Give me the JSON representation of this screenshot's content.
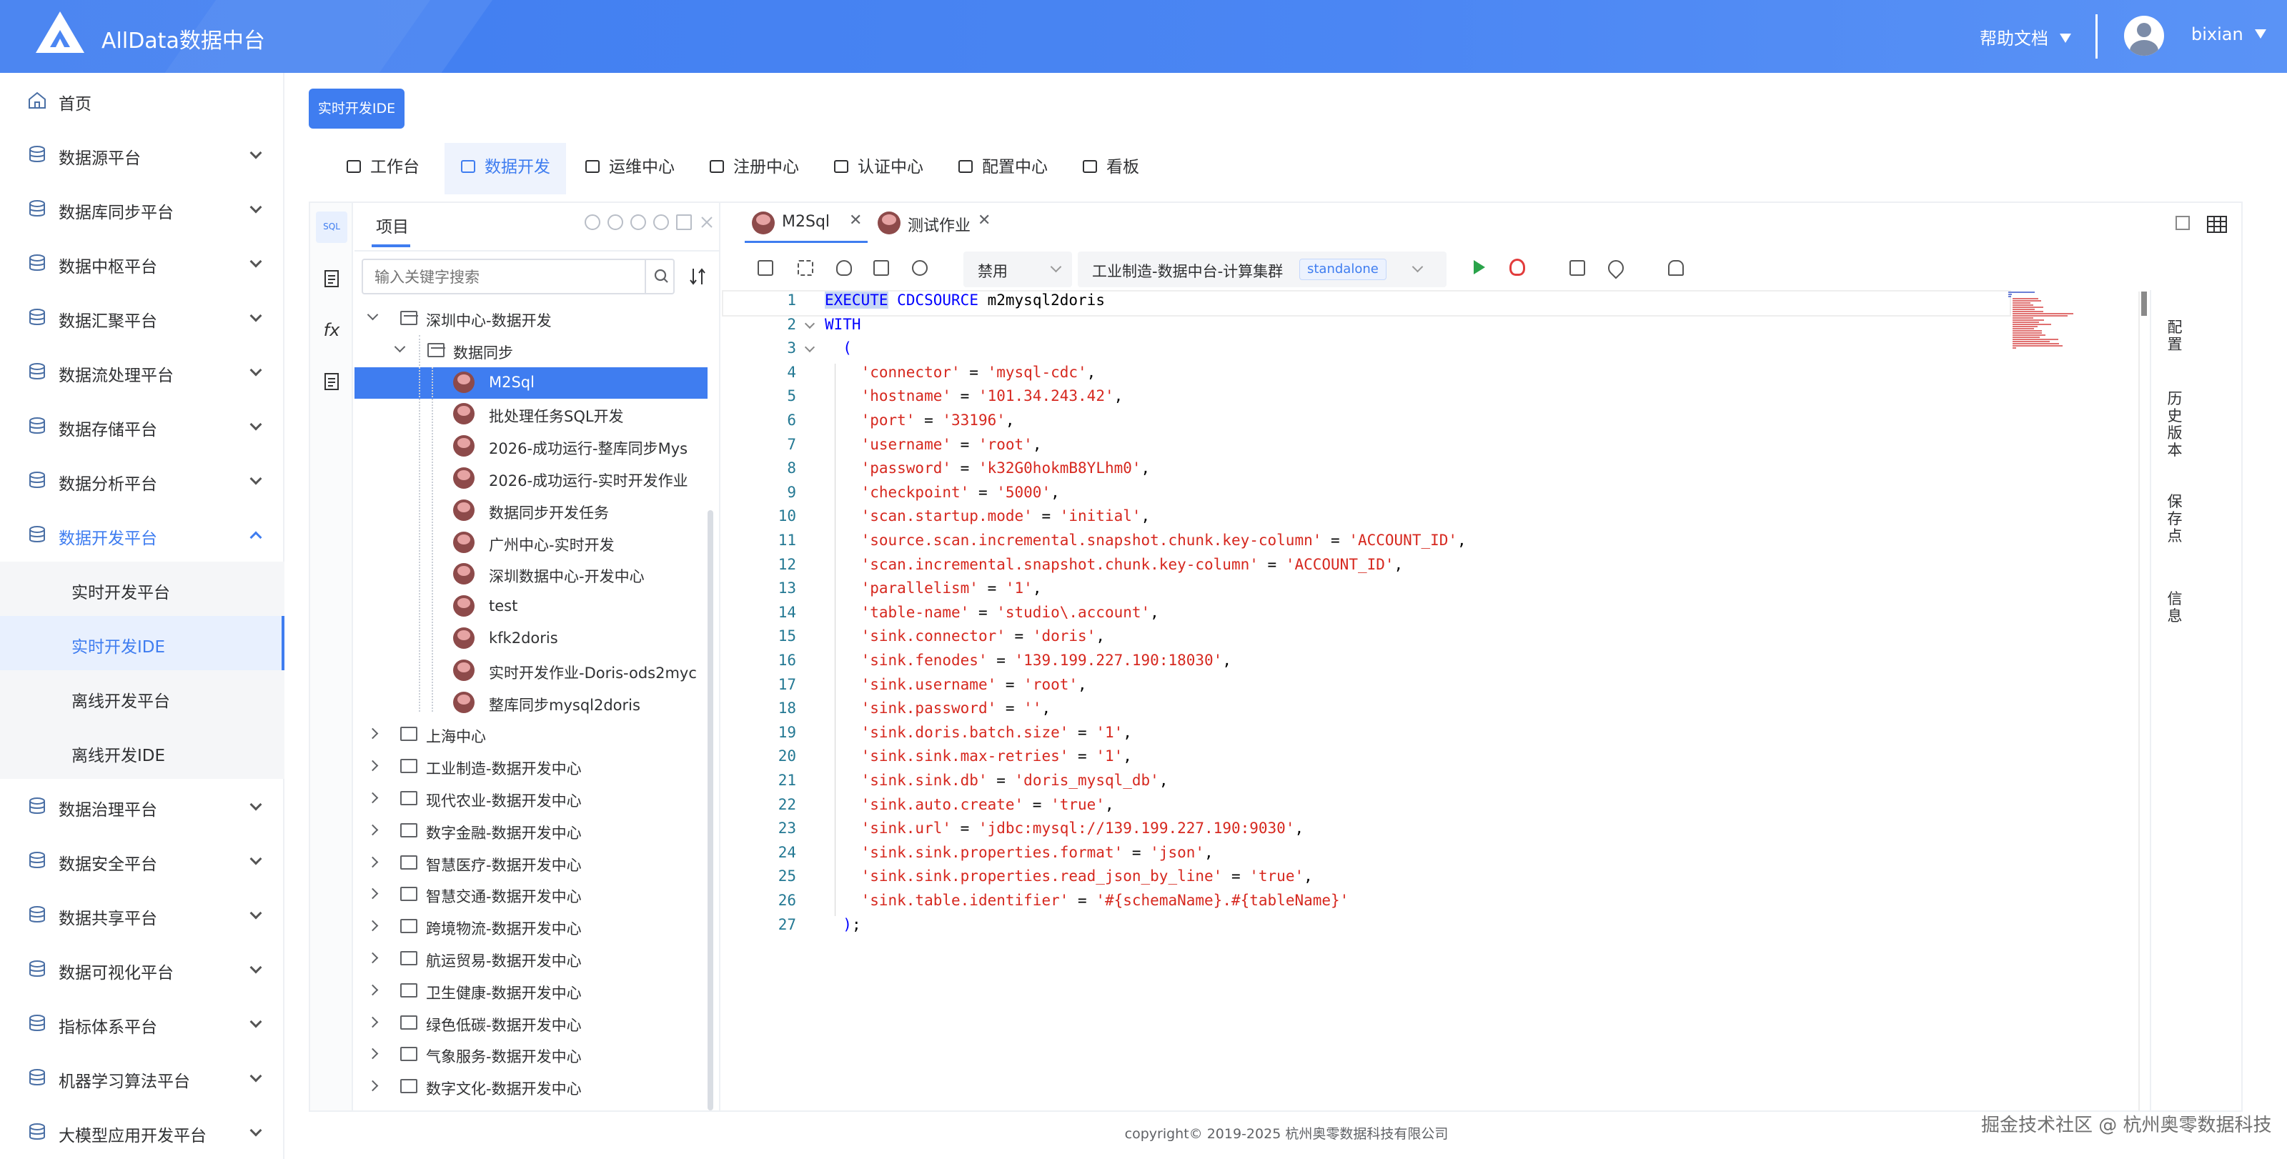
{
  "header": {
    "app_title": "AllData数据中台",
    "help_label": "帮助文档",
    "username": "bixian"
  },
  "sidebar": {
    "items": [
      {
        "label": "首页",
        "icon": "home-icon"
      },
      {
        "label": "数据源平台",
        "icon": "database-icon"
      },
      {
        "label": "数据库同步平台",
        "icon": "sync-icon"
      },
      {
        "label": "数据中枢平台",
        "icon": "hub-icon"
      },
      {
        "label": "数据汇聚平台",
        "icon": "stack-icon"
      },
      {
        "label": "数据流处理平台",
        "icon": "stream-icon"
      },
      {
        "label": "数据存储平台",
        "icon": "storage-icon"
      },
      {
        "label": "数据分析平台",
        "icon": "analysis-icon"
      },
      {
        "label": "数据开发平台",
        "icon": "dev-icon"
      },
      {
        "label": "数据治理平台",
        "icon": "governance-icon"
      },
      {
        "label": "数据安全平台",
        "icon": "security-icon"
      },
      {
        "label": "数据共享平台",
        "icon": "share-icon"
      },
      {
        "label": "数据可视化平台",
        "icon": "visual-icon"
      },
      {
        "label": "指标体系平台",
        "icon": "metrics-icon"
      },
      {
        "label": "机器学习算法平台",
        "icon": "ml-icon"
      },
      {
        "label": "大模型应用开发平台",
        "icon": "llm-icon"
      }
    ],
    "sub_items": [
      "实时开发平台",
      "实时开发IDE",
      "离线开发平台",
      "离线开发IDE"
    ]
  },
  "page_tag": "实时开发IDE",
  "top_tabs": [
    {
      "label": "工作台",
      "icon": "home-icon"
    },
    {
      "label": "数据开发",
      "icon": "terminal-icon"
    },
    {
      "label": "运维中心",
      "icon": "ops-icon"
    },
    {
      "label": "注册中心",
      "icon": "grid-icon"
    },
    {
      "label": "认证中心",
      "icon": "shield-icon"
    },
    {
      "label": "配置中心",
      "icon": "gear-icon"
    },
    {
      "label": "看板",
      "icon": "dashboard-icon"
    }
  ],
  "activity_bar": [
    {
      "label": "SQL",
      "icon": "sql-icon"
    },
    {
      "label": "",
      "icon": "table-icon"
    },
    {
      "label": "fx",
      "icon": "function-icon"
    },
    {
      "label": "",
      "icon": "document-icon"
    }
  ],
  "project": {
    "title": "项目",
    "search_placeholder": "输入关键字搜索",
    "tree": [
      {
        "label": "深圳中心-数据开发",
        "level": 0,
        "type": "folder",
        "expanded": true
      },
      {
        "label": "数据同步",
        "level": 1,
        "type": "folder",
        "expanded": true
      },
      {
        "label": "M2Sql",
        "level": 2,
        "type": "job",
        "selected": true
      },
      {
        "label": "批处理任务SQL开发",
        "level": 2,
        "type": "job"
      },
      {
        "label": "2026-成功运行-整库同步Mys",
        "level": 2,
        "type": "job"
      },
      {
        "label": "2026-成功运行-实时开发作业",
        "level": 2,
        "type": "job"
      },
      {
        "label": "数据同步开发任务",
        "level": 2,
        "type": "job"
      },
      {
        "label": "广州中心-实时开发",
        "level": 2,
        "type": "job"
      },
      {
        "label": "深圳数据中心-开发中心",
        "level": 2,
        "type": "job"
      },
      {
        "label": "test",
        "level": 2,
        "type": "job"
      },
      {
        "label": "kfk2doris",
        "level": 2,
        "type": "job"
      },
      {
        "label": "实时开发作业-Doris-ods2myc",
        "level": 2,
        "type": "job"
      },
      {
        "label": "整库同步mysql2doris",
        "level": 2,
        "type": "job"
      },
      {
        "label": "上海中心",
        "level": 0,
        "type": "folder"
      },
      {
        "label": "工业制造-数据开发中心",
        "level": 0,
        "type": "folder"
      },
      {
        "label": "现代农业-数据开发中心",
        "level": 0,
        "type": "folder"
      },
      {
        "label": "数字金融-数据开发中心",
        "level": 0,
        "type": "folder"
      },
      {
        "label": "智慧医疗-数据开发中心",
        "level": 0,
        "type": "folder"
      },
      {
        "label": "智慧交通-数据开发中心",
        "level": 0,
        "type": "folder"
      },
      {
        "label": "跨境物流-数据开发中心",
        "level": 0,
        "type": "folder"
      },
      {
        "label": "航运贸易-数据开发中心",
        "level": 0,
        "type": "folder"
      },
      {
        "label": "卫生健康-数据开发中心",
        "level": 0,
        "type": "folder"
      },
      {
        "label": "绿色低碳-数据开发中心",
        "level": 0,
        "type": "folder"
      },
      {
        "label": "气象服务-数据开发中心",
        "level": 0,
        "type": "folder"
      },
      {
        "label": "数字文化-数据开发中心",
        "level": 0,
        "type": "folder"
      }
    ]
  },
  "editor": {
    "tabs": [
      {
        "label": "M2Sql",
        "active": true
      },
      {
        "label": "测试作业",
        "active": false
      }
    ],
    "toolbar": {
      "status_select": "禁用",
      "cluster_select": "工业制造-数据中台-计算集群",
      "cluster_badge": "standalone"
    },
    "code_lines": [
      [
        [
          "kw-hl",
          "EXECUTE"
        ],
        [
          "plain",
          " "
        ],
        [
          "kw",
          "CDCSOURCE"
        ],
        [
          "plain",
          " m2mysql2doris"
        ]
      ],
      [
        [
          "kw",
          "WITH"
        ]
      ],
      [
        [
          "plain",
          "  "
        ],
        [
          "kw",
          "("
        ]
      ],
      [
        [
          "plain",
          "    "
        ],
        [
          "str",
          "'connector'"
        ],
        [
          "plain",
          " = "
        ],
        [
          "str",
          "'mysql-cdc'"
        ],
        [
          "plain",
          ","
        ]
      ],
      [
        [
          "plain",
          "    "
        ],
        [
          "str",
          "'hostname'"
        ],
        [
          "plain",
          " = "
        ],
        [
          "str",
          "'101.34.243.42'"
        ],
        [
          "plain",
          ","
        ]
      ],
      [
        [
          "plain",
          "    "
        ],
        [
          "str",
          "'port'"
        ],
        [
          "plain",
          " = "
        ],
        [
          "str",
          "'33196'"
        ],
        [
          "plain",
          ","
        ]
      ],
      [
        [
          "plain",
          "    "
        ],
        [
          "str",
          "'username'"
        ],
        [
          "plain",
          " = "
        ],
        [
          "str",
          "'root'"
        ],
        [
          "plain",
          ","
        ]
      ],
      [
        [
          "plain",
          "    "
        ],
        [
          "str",
          "'password'"
        ],
        [
          "plain",
          " = "
        ],
        [
          "str",
          "'k32G0hokmB8YLhm0'"
        ],
        [
          "plain",
          ","
        ]
      ],
      [
        [
          "plain",
          "    "
        ],
        [
          "str",
          "'checkpoint'"
        ],
        [
          "plain",
          " = "
        ],
        [
          "str",
          "'5000'"
        ],
        [
          "plain",
          ","
        ]
      ],
      [
        [
          "plain",
          "    "
        ],
        [
          "str",
          "'scan.startup.mode'"
        ],
        [
          "plain",
          " = "
        ],
        [
          "str",
          "'initial'"
        ],
        [
          "plain",
          ","
        ]
      ],
      [
        [
          "plain",
          "    "
        ],
        [
          "str",
          "'source.scan.incremental.snapshot.chunk.key-column'"
        ],
        [
          "plain",
          " = "
        ],
        [
          "str",
          "'ACCOUNT_ID'"
        ],
        [
          "plain",
          ","
        ]
      ],
      [
        [
          "plain",
          "    "
        ],
        [
          "str",
          "'scan.incremental.snapshot.chunk.key-column'"
        ],
        [
          "plain",
          " = "
        ],
        [
          "str",
          "'ACCOUNT_ID'"
        ],
        [
          "plain",
          ","
        ]
      ],
      [
        [
          "plain",
          "    "
        ],
        [
          "str",
          "'parallelism'"
        ],
        [
          "plain",
          " = "
        ],
        [
          "str",
          "'1'"
        ],
        [
          "plain",
          ","
        ]
      ],
      [
        [
          "plain",
          "    "
        ],
        [
          "str",
          "'table-name'"
        ],
        [
          "plain",
          " = "
        ],
        [
          "str",
          "'studio\\.account'"
        ],
        [
          "plain",
          ","
        ]
      ],
      [
        [
          "plain",
          "    "
        ],
        [
          "str",
          "'sink.connector'"
        ],
        [
          "plain",
          " = "
        ],
        [
          "str",
          "'doris'"
        ],
        [
          "plain",
          ","
        ]
      ],
      [
        [
          "plain",
          "    "
        ],
        [
          "str",
          "'sink.fenodes'"
        ],
        [
          "plain",
          " = "
        ],
        [
          "str",
          "'139.199.227.190:18030'"
        ],
        [
          "plain",
          ","
        ]
      ],
      [
        [
          "plain",
          "    "
        ],
        [
          "str",
          "'sink.username'"
        ],
        [
          "plain",
          " = "
        ],
        [
          "str",
          "'root'"
        ],
        [
          "plain",
          ","
        ]
      ],
      [
        [
          "plain",
          "    "
        ],
        [
          "str",
          "'sink.password'"
        ],
        [
          "plain",
          " = "
        ],
        [
          "str",
          "''"
        ],
        [
          "plain",
          ","
        ]
      ],
      [
        [
          "plain",
          "    "
        ],
        [
          "str",
          "'sink.doris.batch.size'"
        ],
        [
          "plain",
          " = "
        ],
        [
          "str",
          "'1'"
        ],
        [
          "plain",
          ","
        ]
      ],
      [
        [
          "plain",
          "    "
        ],
        [
          "str",
          "'sink.sink.max-retries'"
        ],
        [
          "plain",
          " = "
        ],
        [
          "str",
          "'1'"
        ],
        [
          "plain",
          ","
        ]
      ],
      [
        [
          "plain",
          "    "
        ],
        [
          "str",
          "'sink.sink.db'"
        ],
        [
          "plain",
          " = "
        ],
        [
          "str",
          "'doris_mysql_db'"
        ],
        [
          "plain",
          ","
        ]
      ],
      [
        [
          "plain",
          "    "
        ],
        [
          "str",
          "'sink.auto.create'"
        ],
        [
          "plain",
          " = "
        ],
        [
          "str",
          "'true'"
        ],
        [
          "plain",
          ","
        ]
      ],
      [
        [
          "plain",
          "    "
        ],
        [
          "str",
          "'sink.url'"
        ],
        [
          "plain",
          " = "
        ],
        [
          "str",
          "'jdbc:mysql://139.199.227.190:9030'"
        ],
        [
          "plain",
          ","
        ]
      ],
      [
        [
          "plain",
          "    "
        ],
        [
          "str",
          "'sink.sink.properties.format'"
        ],
        [
          "plain",
          " = "
        ],
        [
          "str",
          "'json'"
        ],
        [
          "plain",
          ","
        ]
      ],
      [
        [
          "plain",
          "    "
        ],
        [
          "str",
          "'sink.sink.properties.read_json_by_line'"
        ],
        [
          "plain",
          " = "
        ],
        [
          "str",
          "'true'"
        ],
        [
          "plain",
          ","
        ]
      ],
      [
        [
          "plain",
          "    "
        ],
        [
          "str",
          "'sink.table.identifier'"
        ],
        [
          "plain",
          " = "
        ],
        [
          "str",
          "'#{schemaName}.#{tableName}'"
        ]
      ],
      [
        [
          "plain",
          "  "
        ],
        [
          "kw",
          ")"
        ],
        [
          "plain",
          ";"
        ]
      ]
    ],
    "right_rail": [
      "配置",
      "历史版本",
      "保存点",
      "信息"
    ]
  },
  "footer": {
    "copyright": "copyright© 2019-2025 杭州奥零数据科技有限公司",
    "watermark": "掘金技术社区 @ 杭州奥零数据科技"
  },
  "colors": {
    "accent": "#3f7df0",
    "keyword": "#0000ff",
    "string": "#d6281f",
    "line_number": "#237893"
  }
}
